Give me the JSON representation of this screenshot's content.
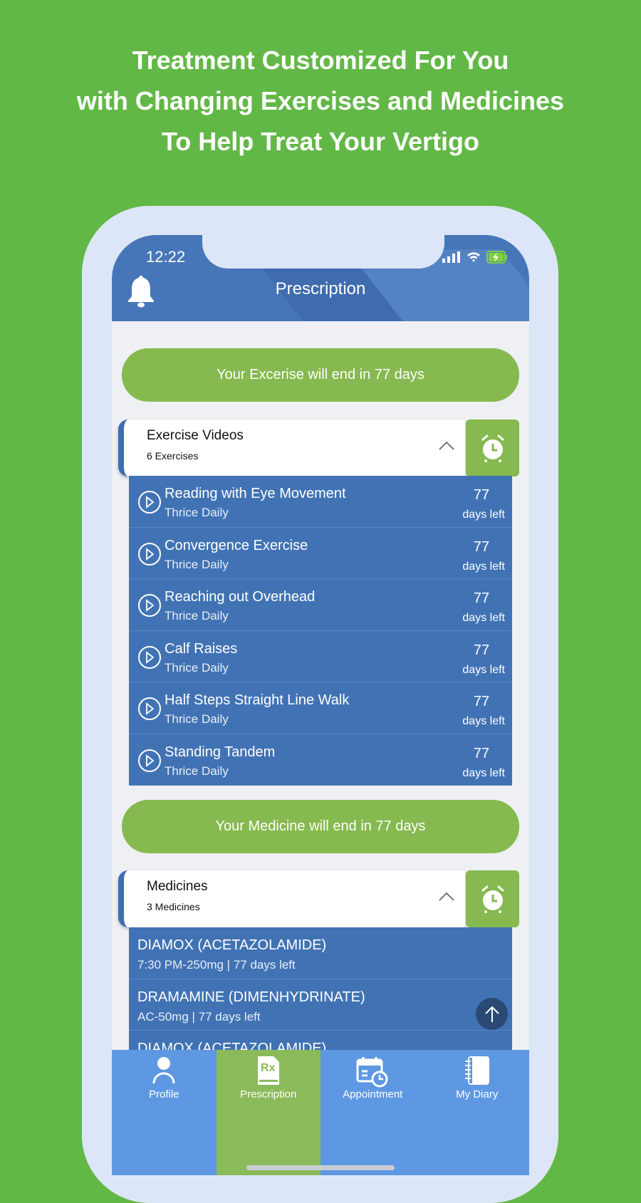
{
  "headline": [
    "Treatment Customized For You",
    "with Changing Exercises and Medicines",
    "To Help Treat Your Vertigo"
  ],
  "status_bar": {
    "time": "12:22",
    "icons": [
      "signal-icon",
      "wifi-icon",
      "battery-charging-icon"
    ]
  },
  "header": {
    "title": "Prescription",
    "left_icon": "bell-icon"
  },
  "exercise": {
    "banner": "Your Excerise will end in 77 days",
    "section_title": "Exercise Videos",
    "section_count": "6 Exercises",
    "items": [
      {
        "name": "Reading with Eye Movement",
        "frequency": "Thrice Daily",
        "days": "77",
        "days_label": "days left"
      },
      {
        "name": "Convergence Exercise",
        "frequency": "Thrice Daily",
        "days": "77",
        "days_label": "days left"
      },
      {
        "name": "Reaching out Overhead",
        "frequency": "Thrice Daily",
        "days": "77",
        "days_label": "days left"
      },
      {
        "name": "Calf Raises",
        "frequency": "Thrice Daily",
        "days": "77",
        "days_label": "days left"
      },
      {
        "name": "Half Steps Straight Line Walk",
        "frequency": "Thrice Daily",
        "days": "77",
        "days_label": "days left"
      },
      {
        "name": "Standing Tandem",
        "frequency": "Thrice Daily",
        "days": "77",
        "days_label": "days left"
      }
    ]
  },
  "medicine": {
    "banner": "Your Medicine will end in 77 days",
    "section_title": "Medicines",
    "section_count": "3 Medicines",
    "items": [
      {
        "name": "DIAMOX (ACETAZOLAMIDE)",
        "detail": "7:30 PM-250mg | 77 days left"
      },
      {
        "name": "DRAMAMINE (DIMENHYDRINATE)",
        "detail": "AC-50mg | 77 days left"
      },
      {
        "name": "DIAMOX (ACETAZOLAMIDE)",
        "detail": ""
      }
    ]
  },
  "nav": [
    {
      "label": "Profile",
      "icon": "person-icon",
      "active": false
    },
    {
      "label": "Prescription",
      "icon": "prescription-icon",
      "active": true
    },
    {
      "label": "Appointment",
      "icon": "calendar-clock-icon",
      "active": false
    },
    {
      "label": "My Diary",
      "icon": "notebook-icon",
      "active": false
    }
  ],
  "colors": {
    "background": "#62b846",
    "header": "#4676b8",
    "accent_green": "#86b94f",
    "list_blue": "#4173b4",
    "nav": "#5e98e3"
  }
}
